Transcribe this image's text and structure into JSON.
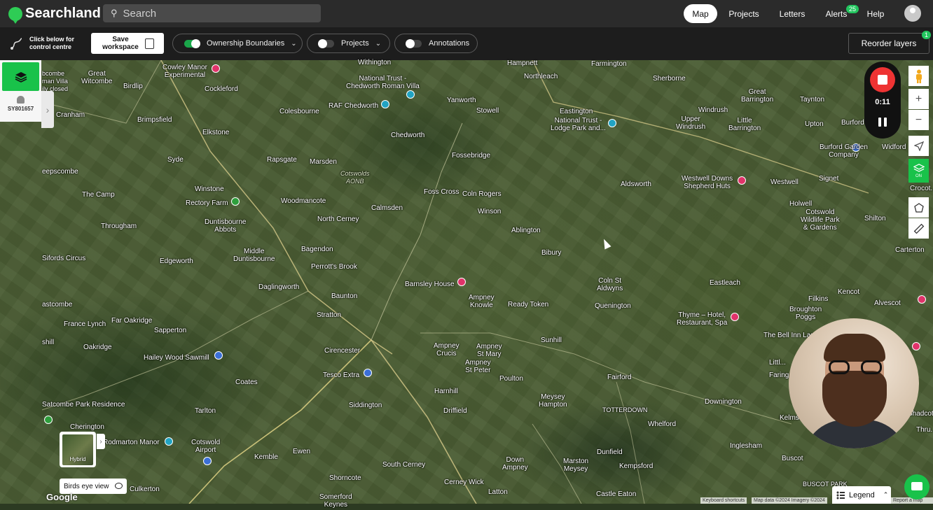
{
  "brand": {
    "name": "Searchland"
  },
  "search": {
    "placeholder": "Search"
  },
  "nav": {
    "map": "Map",
    "projects": "Projects",
    "letters": "Letters",
    "alerts": "Alerts",
    "alerts_count": "25",
    "help": "Help"
  },
  "toolbar": {
    "control_text_line1": "Click below for",
    "control_text_line2": "control centre",
    "save_line1": "Save",
    "save_line2": "workspace",
    "ownership_boundaries": "Ownership Boundaries",
    "projects": "Projects",
    "annotations": "Annotations",
    "reorder_layers": "Reorder layers",
    "reorder_badge": "1"
  },
  "side": {
    "user_id": "SY801657"
  },
  "recording": {
    "time": "0:11"
  },
  "controls": {
    "hybrid": "Hybrid",
    "birds_eye": "Birds eye view",
    "legend": "Legend",
    "keyboard": "Keyboard shortcuts",
    "map_data": "Map data ©2024 Imagery ©2024",
    "report": "Report a map error",
    "google": "Google"
  },
  "places": [
    {
      "t": "Cowley Manor\nExperimental"
    },
    {
      "t": "Great\nWitcombe"
    },
    {
      "t": "Withington"
    },
    {
      "t": "National Trust -\nChedworth Roman Villa"
    },
    {
      "t": "Hampnett"
    },
    {
      "t": "Northleach"
    },
    {
      "t": "Farmington"
    },
    {
      "t": "Sherborne"
    },
    {
      "t": "Great\nBarrington"
    },
    {
      "t": "Taynton"
    },
    {
      "t": "Birdlip"
    },
    {
      "t": "Cockleford"
    },
    {
      "t": "Yanworth"
    },
    {
      "t": "Stowell"
    },
    {
      "t": "RAF Chedworth"
    },
    {
      "t": "Eastington"
    },
    {
      "t": "National Trust -\nLodge Park and..."
    },
    {
      "t": "Windrush"
    },
    {
      "t": "Little\nBarrington"
    },
    {
      "t": "Upton"
    },
    {
      "t": "Burford"
    },
    {
      "t": "Cranham"
    },
    {
      "t": "Colesbourne"
    },
    {
      "t": "Brimpsfield"
    },
    {
      "t": "Elkstone"
    },
    {
      "t": "Chedworth"
    },
    {
      "t": "Upper\nWindrush"
    },
    {
      "t": "Burford Garden\nCompany"
    },
    {
      "t": "Widford"
    },
    {
      "t": "Fossebridge"
    },
    {
      "t": "Syde"
    },
    {
      "t": "Rapsgate"
    },
    {
      "t": "Marsden"
    },
    {
      "t": "Cotswolds\nAONB"
    },
    {
      "t": "Westwell Downs\nShepherd Huts"
    },
    {
      "t": "Westwell"
    },
    {
      "t": "Signet"
    },
    {
      "t": "Aldsworth"
    },
    {
      "t": "Foss Cross"
    },
    {
      "t": "Coln Rogers"
    },
    {
      "t": "Winstone"
    },
    {
      "t": "The Camp"
    },
    {
      "t": "Rectory Farm"
    },
    {
      "t": "Woodmancote"
    },
    {
      "t": "Calmsden"
    },
    {
      "t": "Winson"
    },
    {
      "t": "Holwell"
    },
    {
      "t": "Cotswold\nWildlife Park\n& Gardens"
    },
    {
      "t": "Shilton"
    },
    {
      "t": "Duntisbourne\nAbbots"
    },
    {
      "t": "North Cerney"
    },
    {
      "t": "Ablington"
    },
    {
      "t": "Througham"
    },
    {
      "t": "Middle\nDuntisbourne"
    },
    {
      "t": "Bagendon"
    },
    {
      "t": "Bibury"
    },
    {
      "t": "Carterton"
    },
    {
      "t": "Sifords Circus"
    },
    {
      "t": "Edgeworth"
    },
    {
      "t": "Perrott's Brook"
    },
    {
      "t": "Daglingworth"
    },
    {
      "t": "Barnsley House"
    },
    {
      "t": "Coln St\nAldwyns"
    },
    {
      "t": "Eastleach"
    },
    {
      "t": "Kencot"
    },
    {
      "t": "Baunton"
    },
    {
      "t": "Ampney\nKnowle"
    },
    {
      "t": "Ready Token"
    },
    {
      "t": "Quenington"
    },
    {
      "t": "Filkins"
    },
    {
      "t": "Alvescot"
    },
    {
      "t": "astcombe"
    },
    {
      "t": "Far Oakridge"
    },
    {
      "t": "Stratton"
    },
    {
      "t": "Broughton\nPoggs"
    },
    {
      "t": "Thyme – Hotel,\nRestaurant, Spa"
    },
    {
      "t": "France Lynch"
    },
    {
      "t": "Sapperton"
    },
    {
      "t": "The Bell Inn Lan..."
    },
    {
      "t": "shill"
    },
    {
      "t": "Oakridge"
    },
    {
      "t": "Sunhill"
    },
    {
      "t": "Ampney\nCrucis"
    },
    {
      "t": "Ampney\nSt Mary"
    },
    {
      "t": "Cirencester"
    },
    {
      "t": "Hailey Wood Sawmill"
    },
    {
      "t": "Ampney\nSt Peter"
    },
    {
      "t": "Littl..."
    },
    {
      "t": "Faring..."
    },
    {
      "t": "Tesco Extra"
    },
    {
      "t": "Coates"
    },
    {
      "t": "Poulton"
    },
    {
      "t": "Fairford"
    },
    {
      "t": "Harnhill"
    },
    {
      "t": "Downington"
    },
    {
      "t": "Satcombe Park Residence"
    },
    {
      "t": "Siddington"
    },
    {
      "t": "Meysey\nHampton"
    },
    {
      "t": "Driffield"
    },
    {
      "t": "TOTTERDOWN"
    },
    {
      "t": "Kelms..."
    },
    {
      "t": "Tarlton"
    },
    {
      "t": "Whelford"
    },
    {
      "t": "Cherington"
    },
    {
      "t": "Rodmarton Manor"
    },
    {
      "t": "Cotswold\nAirport"
    },
    {
      "t": "Inglesham"
    },
    {
      "t": "Kemble"
    },
    {
      "t": "Ewen"
    },
    {
      "t": "Dunfield"
    },
    {
      "t": "Marston\nMeysey"
    },
    {
      "t": "Down\nAmpney"
    },
    {
      "t": "Kempsford"
    },
    {
      "t": "Buscot"
    },
    {
      "t": "South Cerney"
    },
    {
      "t": "Shorncote"
    },
    {
      "t": "Cerney Wick"
    },
    {
      "t": "Culkerton"
    },
    {
      "t": "Castle Eaton"
    },
    {
      "t": "Somerford\nKeynes"
    },
    {
      "t": "Latton"
    },
    {
      "t": "BUSCOT PARK"
    },
    {
      "t": "Thru..."
    },
    {
      "t": "Crocot..."
    },
    {
      "t": "Shadcot"
    },
    {
      "t": "bcombe\nman Villa\nily closed"
    },
    {
      "t": "eepscombe"
    }
  ]
}
